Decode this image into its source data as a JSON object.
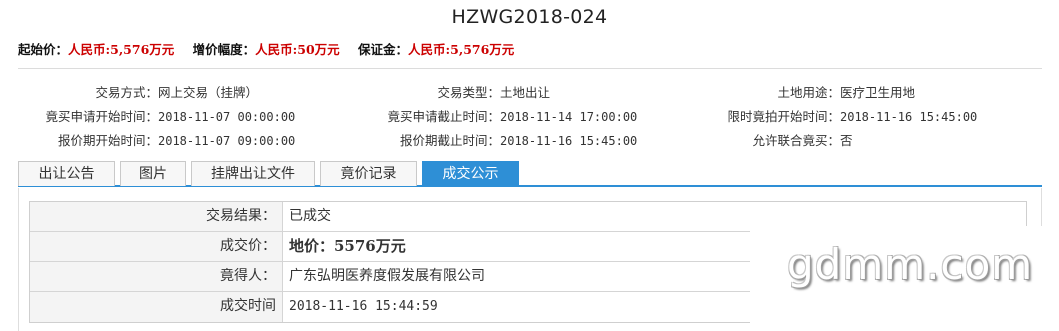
{
  "title": "HZWG2018-024",
  "price_bar": {
    "start_price_label": "起始价：",
    "start_price_value": "人民币:5,576万元",
    "increment_label": "增价幅度：",
    "increment_value": "人民币:50万元",
    "deposit_label": "保证金：",
    "deposit_value": "人民币:5,576万元"
  },
  "info": {
    "trade_method_label": "交易方式：",
    "trade_method_value": "网上交易（挂牌）",
    "trade_type_label": "交易类型：",
    "trade_type_value": "土地出让",
    "land_use_label": "土地用途：",
    "land_use_value": "医疗卫生用地",
    "apply_start_label": "竟买申请开始时间：",
    "apply_start_value": "2018-11-07 00:00:00",
    "apply_end_label": "竟买申请截止时间：",
    "apply_end_value": "2018-11-14 17:00:00",
    "timed_bid_start_label": "限时竟拍开始时间：",
    "timed_bid_start_value": "2018-11-16 15:45:00",
    "quote_start_label": "报价期开始时间：",
    "quote_start_value": "2018-11-07 09:00:00",
    "quote_end_label": "报价期截止时间：",
    "quote_end_value": "2018-11-16 15:45:00",
    "joint_bid_label": "允许联合竟买：",
    "joint_bid_value": "否"
  },
  "tabs": [
    "出让公告",
    "图片",
    "挂牌出让文件",
    "竟价记录",
    "成交公示"
  ],
  "active_tab": "成交公示",
  "result": {
    "rows": [
      {
        "label": "交易结果：",
        "value": "已成交"
      },
      {
        "label": "成交价：",
        "value": "地价：5576万元"
      },
      {
        "label": "竟得人：",
        "value": "广东弘明医养度假发展有限公司"
      },
      {
        "label": "成交时间",
        "value": "2018-11-16 15:44:59"
      }
    ]
  },
  "watermark": "gdmm.com",
  "colors": {
    "accent": "#2e8fd6",
    "price_red": "#cc0000"
  }
}
